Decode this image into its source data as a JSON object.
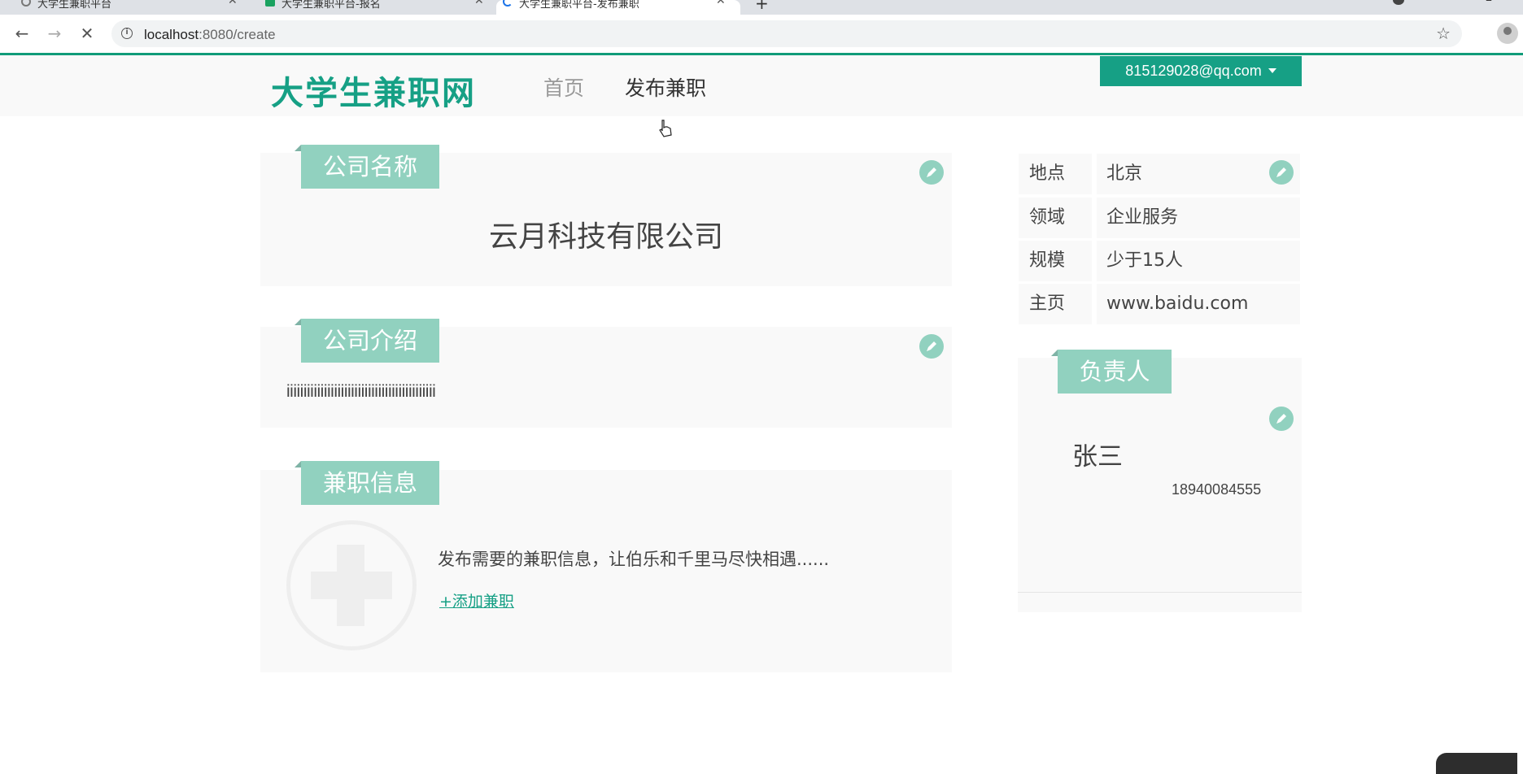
{
  "browser": {
    "tabs": [
      {
        "label": "大学生兼职平台",
        "active": false
      },
      {
        "label": "大学生兼职平台-报名",
        "active": false
      },
      {
        "label": "大学生兼职平台-发布兼职",
        "active": true
      }
    ],
    "url_host": "localhost",
    "url_rest": ":8080/create"
  },
  "header": {
    "logo": "大学生兼职网",
    "nav": {
      "home": "首页",
      "publish": "发布兼职"
    },
    "user_email": "815129028@qq.com"
  },
  "company": {
    "section_title": "公司名称",
    "name": "云月科技有限公司"
  },
  "intro": {
    "section_title": "公司介绍",
    "text": "iiiiiiiiiiiiiiiiiiiiiiiiiiiiiiiiiiiiiiiiiiii"
  },
  "jobs": {
    "section_title": "兼职信息",
    "description": "发布需要的兼职信息，让伯乐和千里马尽快相遇......",
    "add_link": "+添加兼职"
  },
  "info_table": [
    {
      "label": "地点",
      "value": "北京"
    },
    {
      "label": "领域",
      "value": "企业服务"
    },
    {
      "label": "规模",
      "value": "少于15人"
    },
    {
      "label": "主页",
      "value": "www.baidu.com"
    }
  ],
  "contact": {
    "section_title": "负责人",
    "name": "张三",
    "phone": "18940084555"
  },
  "colors": {
    "accent": "#16a085",
    "ribbon": "#91d1bf",
    "card_bg": "#f9f9f9"
  }
}
